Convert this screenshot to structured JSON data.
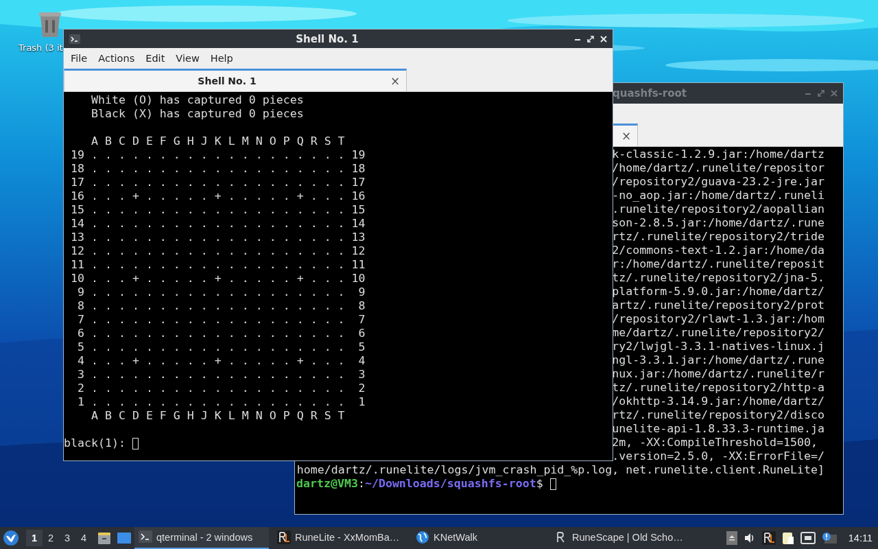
{
  "desktop": {
    "icons": [
      {
        "label": "Trash (3 it"
      }
    ]
  },
  "windows": [
    {
      "title": "quashfs-root",
      "active": false,
      "tabs": [
        {
          "close": "×",
          "selected": true
        }
      ],
      "lines": [
        {
          "text": "k-classic-1.2.9.jar:/home/dartz"
        },
        {
          "text": "/home/dartz/.runelite/repositor"
        },
        {
          "text": "/repository2/guava-23.2-jre.jar"
        },
        {
          "text": "-no_aop.jar:/home/dartz/.runeli"
        },
        {
          "text": ".runelite/repository2/aopallian"
        },
        {
          "text": "son-2.8.5.jar:/home/dartz/.rune"
        },
        {
          "text": "rtz/.runelite/repository2/tride"
        },
        {
          "text": "2/commons-text-1.2.jar:/home/da"
        },
        {
          "text": "r:/home/dartz/.runelite/reposit"
        },
        {
          "text": "tz/.runelite/repository2/jna-5."
        },
        {
          "text": "platform-5.9.0.jar:/home/dartz/"
        },
        {
          "text": "artz/.runelite/repository2/prot"
        },
        {
          "text": "/repository2/rlawt-1.3.jar:/hom"
        },
        {
          "text": "me/dartz/.runelite/repository2/"
        },
        {
          "text": "ry2/lwjgl-3.3.1-natives-linux.j"
        },
        {
          "text": "ngl-3.3.1.jar:/home/dartz/.rune"
        },
        {
          "text": "nux.jar:/home/dartz/.runelite/r"
        },
        {
          "text": "tz/.runelite/repository2/http-a"
        },
        {
          "text": "/okhttp-3.14.9.jar:/home/dartz/"
        },
        {
          "text": "rtz/.runelite/repository2/disco"
        },
        {
          "text": "unelite-api-1.8.33.3-runtime.ja"
        },
        {
          "text": "2m, -XX:CompileThreshold=1500, "
        },
        {
          "text": ".version=2.5.0, -XX:ErrorFile=/"
        },
        {
          "text": "home/dartz/.runelite/logs/jvm_crash_pid_%p.log, net.runelite.client.RuneLite]"
        }
      ],
      "prompt": {
        "user": "dartz@VM3",
        "separator": ":",
        "path": "~/Downloads/squashfs-root",
        "symbol": "$ "
      }
    },
    {
      "title": "Shell No. 1",
      "active": true,
      "menu": [
        "File",
        "Actions",
        "Edit",
        "View",
        "Help"
      ],
      "tabs": [
        {
          "label": "Shell No. 1",
          "close": "×",
          "selected": true
        }
      ],
      "lines": [
        {
          "kind": "text",
          "text": "    White (O) has captured 0 pieces"
        },
        {
          "kind": "text",
          "text": "    Black (X) has captured 0 pieces"
        },
        {
          "kind": "blank"
        },
        {
          "kind": "text",
          "text": "    A B C D E F G H J K L M N O P Q R S T"
        },
        {
          "kind": "text",
          "text": " 19 . . . . . . . . . . . . . . . . . . . 19"
        },
        {
          "kind": "text",
          "text": " 18 . . . . . . . . . . . . . . . . . . . 18"
        },
        {
          "kind": "text",
          "text": " 17 . . . . . . . . . . . . . . . . . . . 17"
        },
        {
          "kind": "text",
          "text": " 16 . . . + . . . . . + . . . . . + . . . 16"
        },
        {
          "kind": "text",
          "text": " 15 . . . . . . . . . . . . . . . . . . . 15"
        },
        {
          "kind": "text",
          "text": " 14 . . . . . . . . . . . . . . . . . . . 14"
        },
        {
          "kind": "text",
          "text": " 13 . . . . . . . . . . . . . . . . . . . 13"
        },
        {
          "kind": "text",
          "text": " 12 . . . . . . . . . . . . . . . . . . . 12"
        },
        {
          "kind": "text",
          "text": " 11 . . . . . . . . . . . . . . . . . . . 11"
        },
        {
          "kind": "text",
          "text": " 10 . . . + . . . . . + . . . . . + . . . 10"
        },
        {
          "kind": "text",
          "text": "  9 . . . . . . . . . . . . . . . . . . .  9"
        },
        {
          "kind": "text",
          "text": "  8 . . . . . . . . . . . . . . . . . . .  8"
        },
        {
          "kind": "text",
          "text": "  7 . . . . . . . . . . . . . . . . . . .  7"
        },
        {
          "kind": "text",
          "text": "  6 . . . . . . . . . . . . . . . . . . .  6"
        },
        {
          "kind": "text",
          "text": "  5 . . . . . . . . . . . . . . . . . . .  5"
        },
        {
          "kind": "text",
          "text": "  4 . . . + . . . . . + . . . . . + . . .  4"
        },
        {
          "kind": "text",
          "text": "  3 . . . . . . . . . . . . . . . . . . .  3"
        },
        {
          "kind": "text",
          "text": "  2 . . . . . . . . . . . . . . . . . . .  2"
        },
        {
          "kind": "text",
          "text": "  1 . . . . . . . . . . . . . . . . . . .  1"
        },
        {
          "kind": "text",
          "text": "    A B C D E F G H J K L M N O P Q R S T"
        },
        {
          "kind": "blank"
        }
      ],
      "prompt": {
        "text": "black(1): "
      }
    }
  ],
  "taskbar": {
    "desktops": [
      {
        "label": "1",
        "selected": true
      },
      {
        "label": "2",
        "selected": false
      },
      {
        "label": "3",
        "selected": false
      },
      {
        "label": "4",
        "selected": false
      }
    ],
    "tasks": [
      {
        "kind": "terminal",
        "label": "qterminal - 2 windows",
        "selected": true
      },
      {
        "kind": "runelite",
        "label": "RuneLite - XxMomBa…",
        "selected": false
      },
      {
        "kind": "globe",
        "label": "KNetWalk",
        "selected": false
      },
      {
        "kind": "runescape",
        "label": "RuneScape | Old Scho…",
        "selected": false
      }
    ],
    "clock": "14:11"
  }
}
